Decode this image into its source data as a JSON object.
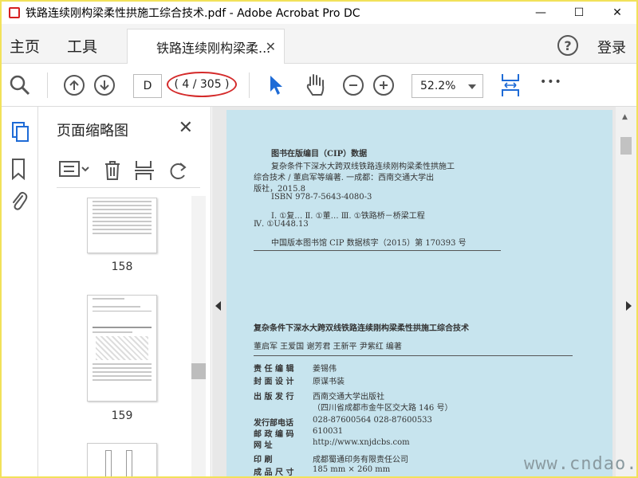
{
  "window": {
    "title": "铁路连续刚构梁柔性拱施工综合技术.pdf - Adobe Acrobat Pro DC",
    "minimize": "—",
    "maximize": "☐",
    "close": "✕"
  },
  "menubar": {
    "home": "主页",
    "tools": "工具",
    "tab_label": "铁路连续刚构梁柔...",
    "tab_close": "✕",
    "help": "?",
    "login": "登录"
  },
  "toolbar": {
    "search_icon": "search-icon",
    "page_input": "D",
    "page_count": "( 4 / 305 )",
    "zoom": "52.2%",
    "more": "•••"
  },
  "thumbnails": {
    "title": "页面缩略图",
    "close": "✕",
    "pages": [
      "158",
      "159"
    ]
  },
  "document": {
    "cip_heading": "图书在版编目（CIP）数据",
    "cip_lines": [
      "复杂条件下深水大跨双线铁路连续刚构梁柔性拱施工",
      "综合技术 / 董启军等编著. 一成都：西南交通大学出",
      "版社，2015.8",
      "ISBN 978-7-5643-4080-3",
      "Ⅰ. ①复…  Ⅱ. ①董…  Ⅲ. ①铁路桥－桥梁工程",
      "Ⅳ. ①U448.13"
    ],
    "cip_number": "中国版本图书馆 CIP 数据核字（2015）第 170393 号",
    "book_title": "复杂条件下深水大跨双线铁路连续刚构梁柔性拱施工综合技术",
    "authors": "董启军   王爱国   谢芳君   王新平   尹紫红   编著",
    "credits": [
      {
        "label": "责 任 编 辑",
        "value": "姜锡伟"
      },
      {
        "label": "封 面 设 计",
        "value": "原谋书装"
      },
      {
        "label": "出 版 发 行",
        "value": "西南交通大学出版社"
      },
      {
        "label": "",
        "value": "（四川省成都市金牛区交大路 146 号）"
      },
      {
        "label": "发行部电话",
        "value": "028-87600564   028-87600533"
      },
      {
        "label": "邮 政 编 码",
        "value": "610031"
      },
      {
        "label": "网       址",
        "value": "http://www.xnjdcbs.com"
      },
      {
        "label": "印       刷",
        "value": "成都蜀通印务有限责任公司"
      },
      {
        "label": "成 品 尺 寸",
        "value": "185 mm × 260 mm"
      }
    ]
  },
  "watermark": "www.cndao.com",
  "colors": {
    "page_bg": "#c7e4ee",
    "accent_blue": "#1e6bd6",
    "highlight_red": "#d42a2a"
  }
}
